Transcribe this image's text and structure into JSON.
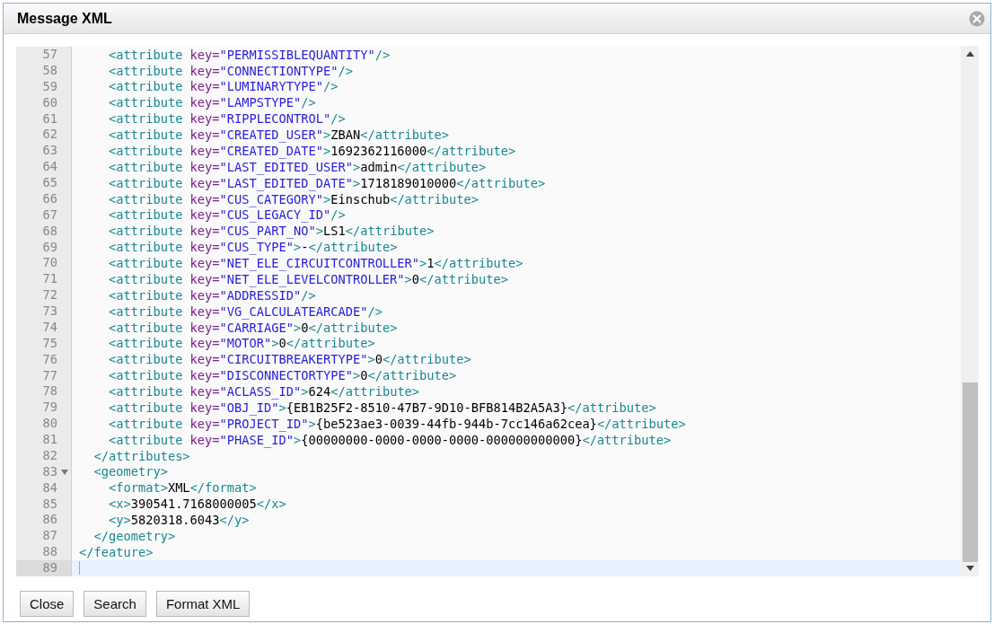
{
  "dialog": {
    "title": "Message XML"
  },
  "editor": {
    "lines": [
      {
        "number": "57",
        "active": false,
        "tokens": [
          {
            "kind": "tag",
            "text": "    <attribute"
          },
          {
            "kind": "attr",
            "text": " key="
          },
          {
            "kind": "string",
            "text": "\"PERMISSIBLEQUANTITY\""
          },
          {
            "kind": "tag",
            "text": "/>"
          }
        ]
      },
      {
        "number": "58",
        "active": false,
        "tokens": [
          {
            "kind": "tag",
            "text": "    <attribute"
          },
          {
            "kind": "attr",
            "text": " key="
          },
          {
            "kind": "string",
            "text": "\"CONNECTIONTYPE\""
          },
          {
            "kind": "tag",
            "text": "/>"
          }
        ]
      },
      {
        "number": "59",
        "active": false,
        "tokens": [
          {
            "kind": "tag",
            "text": "    <attribute"
          },
          {
            "kind": "attr",
            "text": " key="
          },
          {
            "kind": "string",
            "text": "\"LUMINARYTYPE\""
          },
          {
            "kind": "tag",
            "text": "/>"
          }
        ]
      },
      {
        "number": "60",
        "active": false,
        "tokens": [
          {
            "kind": "tag",
            "text": "    <attribute"
          },
          {
            "kind": "attr",
            "text": " key="
          },
          {
            "kind": "string",
            "text": "\"LAMPSTYPE\""
          },
          {
            "kind": "tag",
            "text": "/>"
          }
        ]
      },
      {
        "number": "61",
        "active": false,
        "tokens": [
          {
            "kind": "tag",
            "text": "    <attribute"
          },
          {
            "kind": "attr",
            "text": " key="
          },
          {
            "kind": "string",
            "text": "\"RIPPLECONTROL\""
          },
          {
            "kind": "tag",
            "text": "/>"
          }
        ]
      },
      {
        "number": "62",
        "active": false,
        "tokens": [
          {
            "kind": "tag",
            "text": "    <attribute"
          },
          {
            "kind": "attr",
            "text": " key="
          },
          {
            "kind": "string",
            "text": "\"CREATED_USER\""
          },
          {
            "kind": "tag",
            "text": ">"
          },
          {
            "kind": "text",
            "text": "ZBAN"
          },
          {
            "kind": "tag",
            "text": "</attribute>"
          }
        ]
      },
      {
        "number": "63",
        "active": false,
        "tokens": [
          {
            "kind": "tag",
            "text": "    <attribute"
          },
          {
            "kind": "attr",
            "text": " key="
          },
          {
            "kind": "string",
            "text": "\"CREATED_DATE\""
          },
          {
            "kind": "tag",
            "text": ">"
          },
          {
            "kind": "text",
            "text": "1692362116000"
          },
          {
            "kind": "tag",
            "text": "</attribute>"
          }
        ]
      },
      {
        "number": "64",
        "active": false,
        "tokens": [
          {
            "kind": "tag",
            "text": "    <attribute"
          },
          {
            "kind": "attr",
            "text": " key="
          },
          {
            "kind": "string",
            "text": "\"LAST_EDITED_USER\""
          },
          {
            "kind": "tag",
            "text": ">"
          },
          {
            "kind": "text",
            "text": "admin"
          },
          {
            "kind": "tag",
            "text": "</attribute>"
          }
        ]
      },
      {
        "number": "65",
        "active": false,
        "tokens": [
          {
            "kind": "tag",
            "text": "    <attribute"
          },
          {
            "kind": "attr",
            "text": " key="
          },
          {
            "kind": "string",
            "text": "\"LAST_EDITED_DATE\""
          },
          {
            "kind": "tag",
            "text": ">"
          },
          {
            "kind": "text",
            "text": "1718189010000"
          },
          {
            "kind": "tag",
            "text": "</attribute>"
          }
        ]
      },
      {
        "number": "66",
        "active": false,
        "tokens": [
          {
            "kind": "tag",
            "text": "    <attribute"
          },
          {
            "kind": "attr",
            "text": " key="
          },
          {
            "kind": "string",
            "text": "\"CUS_CATEGORY\""
          },
          {
            "kind": "tag",
            "text": ">"
          },
          {
            "kind": "text",
            "text": "Einschub"
          },
          {
            "kind": "tag",
            "text": "</attribute>"
          }
        ]
      },
      {
        "number": "67",
        "active": false,
        "tokens": [
          {
            "kind": "tag",
            "text": "    <attribute"
          },
          {
            "kind": "attr",
            "text": " key="
          },
          {
            "kind": "string",
            "text": "\"CUS_LEGACY_ID\""
          },
          {
            "kind": "tag",
            "text": "/>"
          }
        ]
      },
      {
        "number": "68",
        "active": false,
        "tokens": [
          {
            "kind": "tag",
            "text": "    <attribute"
          },
          {
            "kind": "attr",
            "text": " key="
          },
          {
            "kind": "string",
            "text": "\"CUS_PART_NO\""
          },
          {
            "kind": "tag",
            "text": ">"
          },
          {
            "kind": "text",
            "text": "LS1"
          },
          {
            "kind": "tag",
            "text": "</attribute>"
          }
        ]
      },
      {
        "number": "69",
        "active": false,
        "tokens": [
          {
            "kind": "tag",
            "text": "    <attribute"
          },
          {
            "kind": "attr",
            "text": " key="
          },
          {
            "kind": "string",
            "text": "\"CUS_TYPE\""
          },
          {
            "kind": "tag",
            "text": ">"
          },
          {
            "kind": "text",
            "text": "-"
          },
          {
            "kind": "tag",
            "text": "</attribute>"
          }
        ]
      },
      {
        "number": "70",
        "active": false,
        "tokens": [
          {
            "kind": "tag",
            "text": "    <attribute"
          },
          {
            "kind": "attr",
            "text": " key="
          },
          {
            "kind": "string",
            "text": "\"NET_ELE_CIRCUITCONTROLLER\""
          },
          {
            "kind": "tag",
            "text": ">"
          },
          {
            "kind": "text",
            "text": "1"
          },
          {
            "kind": "tag",
            "text": "</attribute>"
          }
        ]
      },
      {
        "number": "71",
        "active": false,
        "tokens": [
          {
            "kind": "tag",
            "text": "    <attribute"
          },
          {
            "kind": "attr",
            "text": " key="
          },
          {
            "kind": "string",
            "text": "\"NET_ELE_LEVELCONTROLLER\""
          },
          {
            "kind": "tag",
            "text": ">"
          },
          {
            "kind": "text",
            "text": "0"
          },
          {
            "kind": "tag",
            "text": "</attribute>"
          }
        ]
      },
      {
        "number": "72",
        "active": false,
        "tokens": [
          {
            "kind": "tag",
            "text": "    <attribute"
          },
          {
            "kind": "attr",
            "text": " key="
          },
          {
            "kind": "string",
            "text": "\"ADDRESSID\""
          },
          {
            "kind": "tag",
            "text": "/>"
          }
        ]
      },
      {
        "number": "73",
        "active": false,
        "tokens": [
          {
            "kind": "tag",
            "text": "    <attribute"
          },
          {
            "kind": "attr",
            "text": " key="
          },
          {
            "kind": "string",
            "text": "\"VG_CALCULATEARCADE\""
          },
          {
            "kind": "tag",
            "text": "/>"
          }
        ]
      },
      {
        "number": "74",
        "active": false,
        "tokens": [
          {
            "kind": "tag",
            "text": "    <attribute"
          },
          {
            "kind": "attr",
            "text": " key="
          },
          {
            "kind": "string",
            "text": "\"CARRIAGE\""
          },
          {
            "kind": "tag",
            "text": ">"
          },
          {
            "kind": "text",
            "text": "0"
          },
          {
            "kind": "tag",
            "text": "</attribute>"
          }
        ]
      },
      {
        "number": "75",
        "active": false,
        "tokens": [
          {
            "kind": "tag",
            "text": "    <attribute"
          },
          {
            "kind": "attr",
            "text": " key="
          },
          {
            "kind": "string",
            "text": "\"MOTOR\""
          },
          {
            "kind": "tag",
            "text": ">"
          },
          {
            "kind": "text",
            "text": "0"
          },
          {
            "kind": "tag",
            "text": "</attribute>"
          }
        ]
      },
      {
        "number": "76",
        "active": false,
        "tokens": [
          {
            "kind": "tag",
            "text": "    <attribute"
          },
          {
            "kind": "attr",
            "text": " key="
          },
          {
            "kind": "string",
            "text": "\"CIRCUITBREAKERTYPE\""
          },
          {
            "kind": "tag",
            "text": ">"
          },
          {
            "kind": "text",
            "text": "0"
          },
          {
            "kind": "tag",
            "text": "</attribute>"
          }
        ]
      },
      {
        "number": "77",
        "active": false,
        "tokens": [
          {
            "kind": "tag",
            "text": "    <attribute"
          },
          {
            "kind": "attr",
            "text": " key="
          },
          {
            "kind": "string",
            "text": "\"DISCONNECTORTYPE\""
          },
          {
            "kind": "tag",
            "text": ">"
          },
          {
            "kind": "text",
            "text": "0"
          },
          {
            "kind": "tag",
            "text": "</attribute>"
          }
        ]
      },
      {
        "number": "78",
        "active": false,
        "tokens": [
          {
            "kind": "tag",
            "text": "    <attribute"
          },
          {
            "kind": "attr",
            "text": " key="
          },
          {
            "kind": "string",
            "text": "\"ACLASS_ID\""
          },
          {
            "kind": "tag",
            "text": ">"
          },
          {
            "kind": "text",
            "text": "624"
          },
          {
            "kind": "tag",
            "text": "</attribute>"
          }
        ]
      },
      {
        "number": "79",
        "active": false,
        "tokens": [
          {
            "kind": "tag",
            "text": "    <attribute"
          },
          {
            "kind": "attr",
            "text": " key="
          },
          {
            "kind": "string",
            "text": "\"OBJ_ID\""
          },
          {
            "kind": "tag",
            "text": ">"
          },
          {
            "kind": "text",
            "text": "{EB1B25F2-8510-47B7-9D10-BFB814B2A5A3}"
          },
          {
            "kind": "tag",
            "text": "</attribute>"
          }
        ]
      },
      {
        "number": "80",
        "active": false,
        "tokens": [
          {
            "kind": "tag",
            "text": "    <attribute"
          },
          {
            "kind": "attr",
            "text": " key="
          },
          {
            "kind": "string",
            "text": "\"PROJECT_ID\""
          },
          {
            "kind": "tag",
            "text": ">"
          },
          {
            "kind": "text",
            "text": "{be523ae3-0039-44fb-944b-7cc146a62cea}"
          },
          {
            "kind": "tag",
            "text": "</attribute>"
          }
        ]
      },
      {
        "number": "81",
        "active": false,
        "tokens": [
          {
            "kind": "tag",
            "text": "    <attribute"
          },
          {
            "kind": "attr",
            "text": " key="
          },
          {
            "kind": "string",
            "text": "\"PHASE_ID\""
          },
          {
            "kind": "tag",
            "text": ">"
          },
          {
            "kind": "text",
            "text": "{00000000-0000-0000-0000-000000000000}"
          },
          {
            "kind": "tag",
            "text": "</attribute>"
          }
        ]
      },
      {
        "number": "82",
        "active": false,
        "tokens": [
          {
            "kind": "tag",
            "text": "  </attributes>"
          }
        ]
      },
      {
        "number": "83",
        "active": false,
        "expanded": true,
        "tokens": [
          {
            "kind": "tag",
            "text": "  <geometry>"
          }
        ]
      },
      {
        "number": "84",
        "active": false,
        "tokens": [
          {
            "kind": "tag",
            "text": "    <format>"
          },
          {
            "kind": "text",
            "text": "XML"
          },
          {
            "kind": "tag",
            "text": "</format>"
          }
        ]
      },
      {
        "number": "85",
        "active": false,
        "tokens": [
          {
            "kind": "tag",
            "text": "    <x>"
          },
          {
            "kind": "text",
            "text": "390541.7168000005"
          },
          {
            "kind": "tag",
            "text": "</x>"
          }
        ]
      },
      {
        "number": "86",
        "active": false,
        "tokens": [
          {
            "kind": "tag",
            "text": "    <y>"
          },
          {
            "kind": "text",
            "text": "5820318.6043"
          },
          {
            "kind": "tag",
            "text": "</y>"
          }
        ]
      },
      {
        "number": "87",
        "active": false,
        "tokens": [
          {
            "kind": "tag",
            "text": "  </geometry>"
          }
        ]
      },
      {
        "number": "88",
        "active": false,
        "tokens": [
          {
            "kind": "tag",
            "text": "</feature>"
          }
        ]
      },
      {
        "number": "89",
        "active": true
      }
    ]
  },
  "buttons": [
    {
      "label": "Close"
    },
    {
      "label": "Search"
    },
    {
      "label": "Format XML"
    }
  ]
}
